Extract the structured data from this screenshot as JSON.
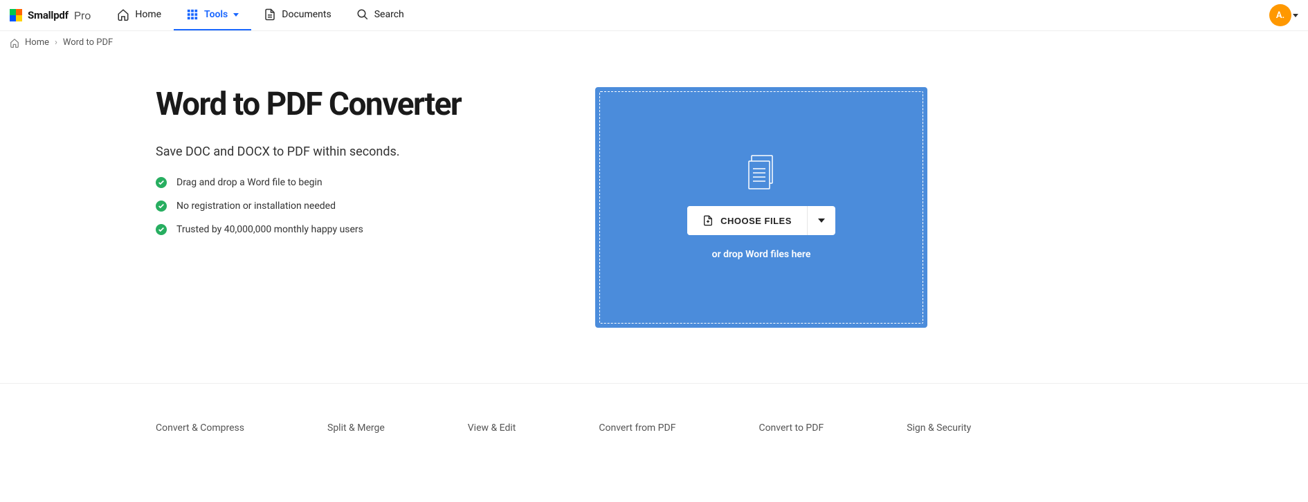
{
  "brand": {
    "name": "Smallpdf",
    "tier": "Pro"
  },
  "nav": {
    "home": "Home",
    "tools": "Tools",
    "documents": "Documents",
    "search": "Search"
  },
  "avatar": {
    "initial": "A."
  },
  "breadcrumb": {
    "home": "Home",
    "current": "Word to PDF"
  },
  "hero": {
    "title": "Word to PDF Converter",
    "subtitle": "Save DOC and DOCX to PDF within seconds.",
    "features": [
      "Drag and drop a Word file to begin",
      "No registration or installation needed",
      "Trusted by 40,000,000 monthly happy users"
    ]
  },
  "upload": {
    "button": "CHOOSE FILES",
    "hint": "or drop Word files here"
  },
  "categories": [
    "Convert & Compress",
    "Split & Merge",
    "View & Edit",
    "Convert from PDF",
    "Convert to PDF",
    "Sign & Security"
  ]
}
